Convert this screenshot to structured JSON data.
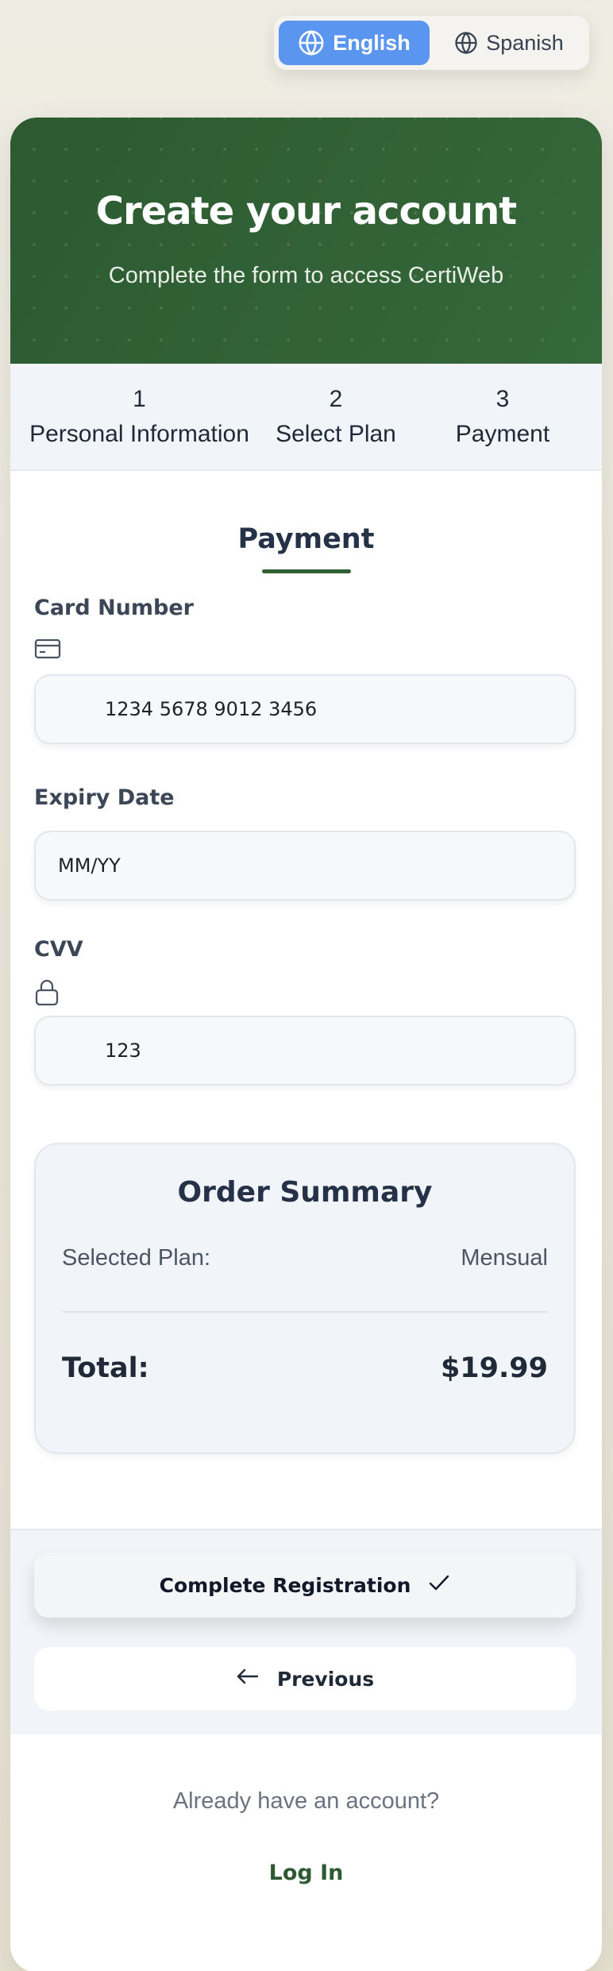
{
  "language_switch": {
    "english": "English",
    "spanish": "Spanish",
    "active": "English"
  },
  "hero": {
    "title": "Create your account",
    "subtitle": "Complete the form to access CertiWeb"
  },
  "steps": [
    {
      "number": "1",
      "label": "Personal Information"
    },
    {
      "number": "2",
      "label": "Select Plan"
    },
    {
      "number": "3",
      "label": "Payment"
    }
  ],
  "payment": {
    "section_title": "Payment",
    "card_number": {
      "label": "Card Number",
      "placeholder": "1234 5678 9012 3456",
      "icon": "credit-card-icon"
    },
    "expiry_date": {
      "label": "Expiry Date",
      "placeholder": "MM/YY"
    },
    "cvv": {
      "label": "CVV",
      "placeholder": "123",
      "icon": "lock-icon"
    }
  },
  "order_summary": {
    "title": "Order Summary",
    "selected_plan_label": "Selected Plan:",
    "selected_plan_value": "Mensual",
    "total_label": "Total:",
    "total_value": "$19.99"
  },
  "actions": {
    "complete_label": "Complete Registration",
    "previous_label": "Previous"
  },
  "footer": {
    "prompt": "Already have an account?",
    "login_label": "Log In"
  },
  "colors": {
    "brand_green": "#2f5f34",
    "active_language": "#5a95f0",
    "page_background": "#e9e4d6"
  }
}
